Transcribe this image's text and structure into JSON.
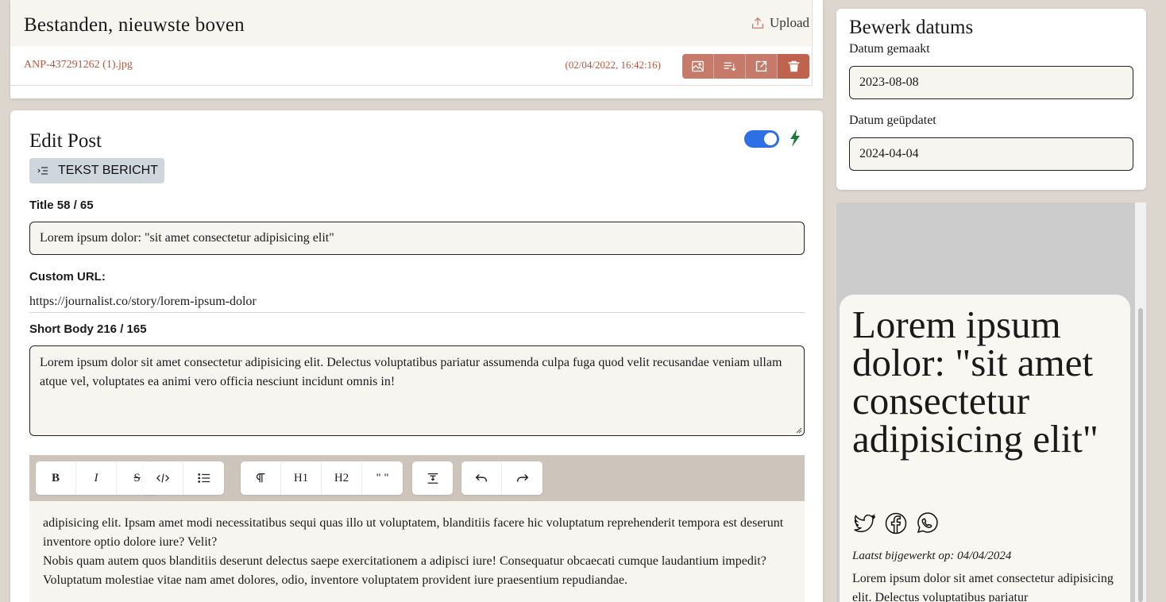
{
  "files": {
    "title": "Bestanden, nieuwste boven",
    "upload_label": "Upload",
    "items": [
      {
        "name": "ANP-437291262 (1).jpg",
        "date": "(02/04/2022, 16:42:16)"
      }
    ],
    "action_icons": [
      "image-icon",
      "sort-icon",
      "external-link-icon",
      "trash-icon"
    ],
    "accent_color": "#c77a6a"
  },
  "editor": {
    "title": "Edit Post",
    "toggle_on": true,
    "post_type": "TEKST BERICHT",
    "title_label": "Title 58 / 65",
    "title_value": "Lorem ipsum dolor: \"sit amet consectetur adipisicing elit\"",
    "url_label": "Custom URL:",
    "url_value": "https://journalist.co/story/lorem-ipsum-dolor",
    "short_body_label": "Short Body 216 / 165",
    "short_body_value": "Lorem ipsum dolor sit amet consectetur adipisicing elit. Delectus voluptatibus pariatur assumenda culpa fuga quod velit recusandae veniam ullam atque vel, voluptates ea animi vero officia nesciunt incidunt omnis in!",
    "toolbar": {
      "bold": "B",
      "italic": "I",
      "strike": "S",
      "h1": "H1",
      "h2": "H2",
      "quote": "\" \""
    },
    "body_paragraph_1": "adipisicing elit. Ipsam amet modi necessitatibus sequi quas illo ut voluptatem, blanditiis facere hic voluptatum reprehenderit tempora est deserunt inventore optio dolore iure? Velit?",
    "body_paragraph_2": "Nobis quam autem quos blanditiis deserunt delectus saepe exercitationem a adipisci iure! Consequatur obcaecati cumque laudantium impedit? Voluptatum molestiae vitae nam amet dolores, odio, inventore voluptatem provident iure praesentium repudiandae."
  },
  "dates": {
    "title": "Bewerk datums",
    "created_label": "Datum gemaakt",
    "created_value": "2023-08-08",
    "updated_label": "Datum geüpdatet",
    "updated_value": "2024-04-04"
  },
  "preview": {
    "title": "Lorem ipsum dolor: \"sit amet consectetur adipisicing elit\"",
    "social_icons": [
      "twitter-icon",
      "facebook-icon",
      "whatsapp-icon"
    ],
    "updated_text": "Laatst bijgewerkt op: 04/04/2024",
    "body": "Lorem ipsum dolor sit amet consectetur adipisicing elit. Delectus voluptatibus pariatur"
  },
  "colors": {
    "background": "#dcd6ce",
    "toggle_blue": "#2f6fe6",
    "flash_green": "#1e7a3c",
    "toolbar_bg": "#cdc5bc"
  }
}
